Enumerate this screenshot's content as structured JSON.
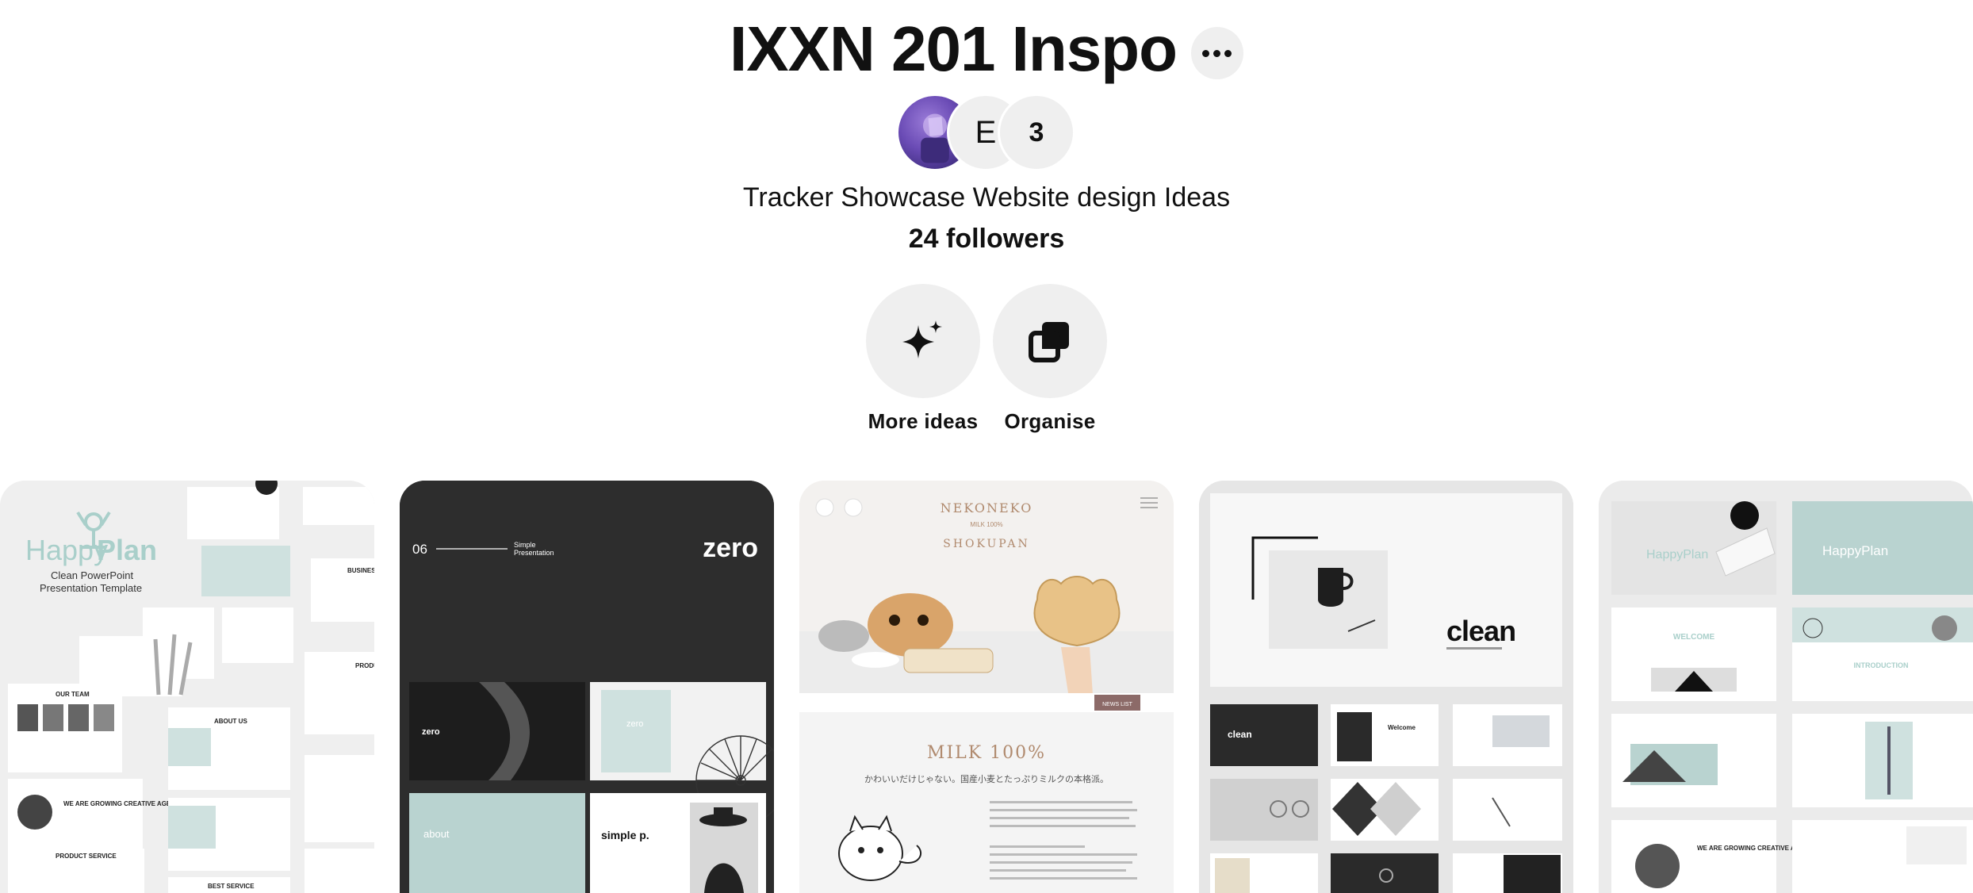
{
  "board": {
    "title": "IXXN 201 Inspo",
    "collaborator_initial": "E",
    "collaborator_extra_count": "3",
    "description": "Tracker Showcase Website design Ideas",
    "followers": "24 followers"
  },
  "actions": [
    {
      "label": "More ideas",
      "icon": "sparkle-icon"
    },
    {
      "label": "Organise",
      "icon": "organise-icon"
    }
  ],
  "pins": {
    "p1": {
      "brand": "HappyPlan",
      "brand_a": "Happy",
      "brand_b": "Plan",
      "subtitle": "Clean PowerPoint Presentation Template",
      "sub1": "Clean PowerPoint",
      "sub2": "Presentation Template",
      "t1": "ABOUT US",
      "t2": "OUR TEAM",
      "t3": "WE ARE GROWING CREATIVE AGENCY HAPPYPLAN",
      "t4": "PRODUCT SERVICE",
      "t5": "BEST SERVICE",
      "t6": "BUSINESS",
      "t7": "PRODU"
    },
    "p2": {
      "number": "06",
      "label1": "Simple",
      "label2": "Presentation",
      "brand": "zero",
      "slide_a": "zero",
      "slide_b": "zero",
      "slide_c": "about",
      "slide_d": "simple p."
    },
    "p3": {
      "brand": "NEKONEKO",
      "sub": "MILK 100%",
      "arc": "SHOKUPAN",
      "banner": "NEWS LIST",
      "headline": "MILK 100%",
      "tagline": "かわいいだけじゃない。国産小麦とたっぷりミルクの本格派。"
    },
    "p4": {
      "brand": "clean",
      "slide_a": "clean",
      "slide_b": "Welcome"
    },
    "p5": {
      "brand": "HappyPlan",
      "welcome": "WELCOME",
      "intro": "INTRODUCTION",
      "growing": "WE ARE GROWING CREATIVE AGENCY HAPPYPLAN"
    }
  },
  "colors": {
    "accent_mint": "#a9cfca",
    "neko_brown": "#b08a6e",
    "pill_bg": "#efefef"
  }
}
